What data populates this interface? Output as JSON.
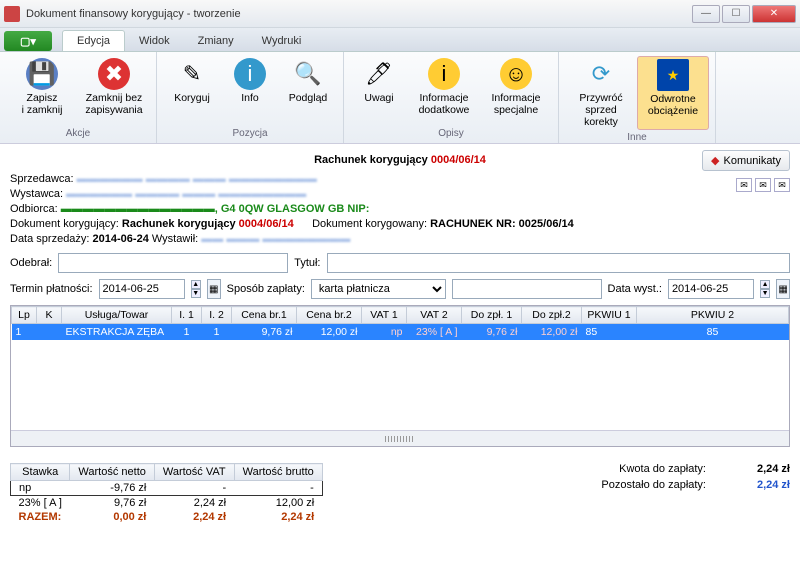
{
  "window": {
    "title": "Dokument finansowy korygujący - tworzenie"
  },
  "tabs": {
    "edycja": "Edycja",
    "widok": "Widok",
    "zmiany": "Zmiany",
    "wydruki": "Wydruki"
  },
  "ribbon": {
    "akcje": {
      "title": "Akcje",
      "zapisz": "Zapisz\ni zamknij",
      "zamknij": "Zamknij bez\nzapisywania"
    },
    "pozycja": {
      "title": "Pozycja",
      "koryguj": "Koryguj",
      "info": "Info",
      "podglad": "Podgląd"
    },
    "opisy": {
      "title": "Opisy",
      "uwagi": "Uwagi",
      "infodod": "Informacje\ndodatkowe",
      "infospec": "Informacje\nspecjalne"
    },
    "inne": {
      "title": "Inne",
      "przywroc": "Przywróć\nsprzed korekty",
      "odwrotne": "Odwrotne\nobciążenie"
    }
  },
  "doc": {
    "title_prefix": "Rachunek korygujący ",
    "title_number": "0004/06/14",
    "komunikaty": "Komunikaty",
    "sprzedawca_label": "Sprzedawca:",
    "wystawca_label": "Wystawca:",
    "odbiorca_label": "Odbiorca:",
    "odbiorca_tail": ", G4 0QW GLASGOW GB NIP:",
    "korygujacy_label": "Dokument korygujący: ",
    "korygujacy_name": "Rachunek korygujący ",
    "korygujacy_num": "0004/06/14",
    "korygowany_label": "Dokument korygowany: ",
    "korygowany_name": "RACHUNEK NR: 0025/06/14",
    "data_sprz_label": "Data sprzedaży: ",
    "data_sprz": "2014-06-24",
    "wystawil_label": " Wystawił: "
  },
  "form": {
    "odebral": "Odebrał:",
    "tytul": "Tytuł:",
    "termin": "Termin płatności:",
    "termin_val": "2014-06-25",
    "sposob": "Sposób zapłaty:",
    "sposob_val": "karta płatnicza",
    "data_wyst": "Data wyst.:",
    "data_wyst_val": "2014-06-25"
  },
  "items": {
    "headers": {
      "lp": "Lp",
      "k": "K",
      "usluga": "Usługa/Towar",
      "i1": "I. 1",
      "i2": "I. 2",
      "cena1": "Cena br.1",
      "cena2": "Cena br.2",
      "vat1": "VAT 1",
      "vat2": "VAT 2",
      "dozpl1": "Do zpł. 1",
      "dozpl2": "Do zpł.2",
      "pkwiu1": "PKWIU 1",
      "pkwiu2": "PKWIU 2"
    },
    "rows": [
      {
        "lp": "1",
        "k": "",
        "usluga": "EKSTRAKCJA ZĘBA",
        "i1": "1",
        "i2": "1",
        "cena1": "9,76 zł",
        "cena2": "12,00 zł",
        "vat1": "np",
        "vat2": "23% [ A ]",
        "dozpl1": "9,76 zł",
        "dozpl2": "12,00 zł",
        "pkwiu1": "85",
        "pkwiu2": "85"
      }
    ]
  },
  "vat": {
    "headers": {
      "stawka": "Stawka",
      "netto": "Wartość netto",
      "vat": "Wartość VAT",
      "brutto": "Wartość brutto"
    },
    "rows": [
      {
        "stawka": "np",
        "netto": "-9,76 zł",
        "vat": "-",
        "brutto": "-"
      },
      {
        "stawka": "23% [ A ]",
        "netto": "9,76 zł",
        "vat": "2,24 zł",
        "brutto": "12,00 zł"
      }
    ],
    "total": {
      "label": "RAZEM:",
      "netto": "0,00 zł",
      "vat": "2,24 zł",
      "brutto": "2,24 zł"
    }
  },
  "totals": {
    "kwota_label": "Kwota do zapłaty:",
    "kwota": "2,24 zł",
    "pozostalo_label": "Pozostało do zapłaty:",
    "pozostalo": "2,24 zł"
  }
}
